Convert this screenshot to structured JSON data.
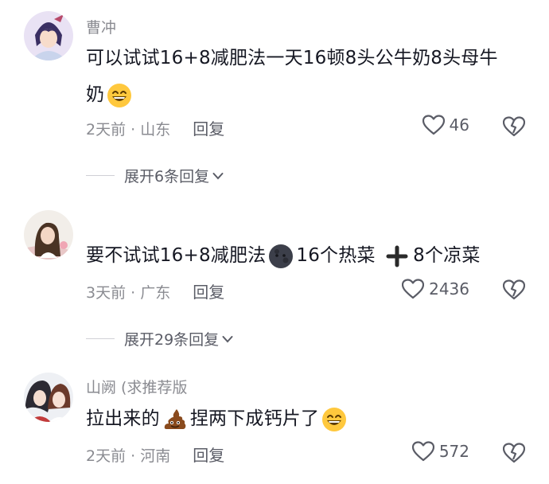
{
  "comments": [
    {
      "username": "曹冲",
      "text": "可以试试16+8减肥法一天16顿8头公牛奶8头母牛奶",
      "emoji": "grin-emoji",
      "time_location": "2天前 · 山东",
      "reply_label": "回复",
      "likes": "46",
      "expand_label": "展开6条回复"
    },
    {
      "username": "",
      "text_a": "要不试试16+8减肥法",
      "text_b": "16个热菜",
      "text_c": "8个凉菜",
      "time_location": "3天前 · 广东",
      "reply_label": "回复",
      "likes": "2436",
      "expand_label": "展开29条回复"
    },
    {
      "username": "山阙 (求推荐版",
      "text_a": "拉出来的",
      "text_b": "捏两下成钙片了",
      "time_location": "2天前 · 河南",
      "reply_label": "回复",
      "likes": "572"
    }
  ],
  "colors": {
    "meta": "#8a8b91",
    "text": "#161823",
    "action": "#5a5c66"
  }
}
